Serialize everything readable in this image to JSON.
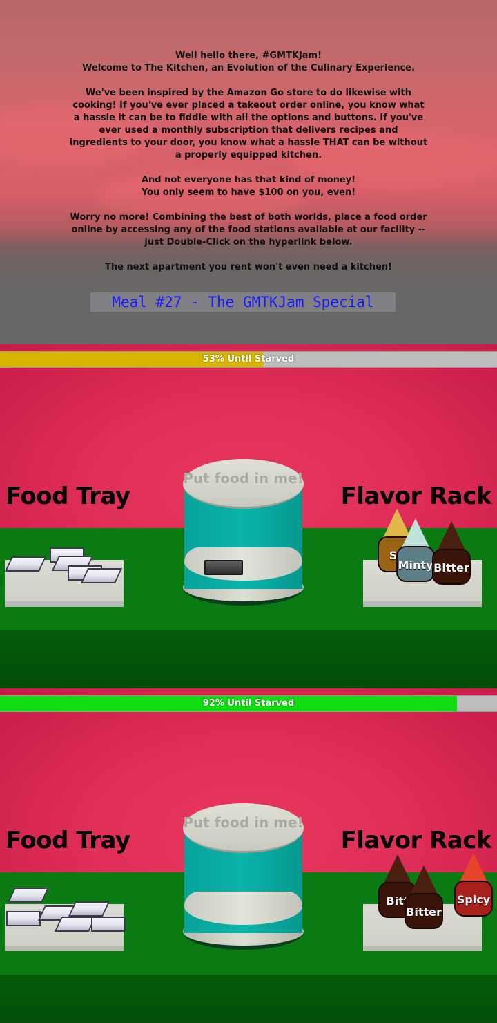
{
  "intro": {
    "paragraphs": [
      "Well hello there, #GMTKJam!\nWelcome to The Kitchen, an Evolution of the Culinary Experience.",
      "We've been inspired by the Amazon Go store to do likewise with cooking! If you've ever placed a takeout order online, you know what a hassle it can be to fiddle with all the options and buttons. If you've ever used a monthly subscription that delivers recipes and ingredients to your door, you know what a hassle THAT can be without a properly equipped kitchen.",
      "And not everyone has that kind of money!\nYou only seem to have $100 on you, even!",
      "Worry no more! Combining the best of both worlds, place a food order online by accessing any of the food stations available at our facility -- just Double-Click on the hyperlink below.",
      "The next apartment you rent won't even need a kitchen!"
    ],
    "link_text": "Meal #27 - The GMTKJam Special"
  },
  "scenes": [
    {
      "hunger": {
        "percent": 53,
        "label": "53% Until Starved",
        "color": "#d6b400"
      },
      "food_tray_title": "Food Tray",
      "flavor_rack_title": "Flavor Rack",
      "tube_label": "Put food in me!",
      "bottles": [
        {
          "label": "So",
          "cap": "#e0b84a",
          "body": "#9a6416"
        },
        {
          "label": "Minty",
          "cap": "#bfe3dc",
          "body": "#5f7f88"
        },
        {
          "label": "Bitter",
          "cap": "#4b1f10",
          "body": "#3a1409"
        }
      ]
    },
    {
      "hunger": {
        "percent": 92,
        "label": "92% Until Starved",
        "color": "#10dc10"
      },
      "food_tray_title": "Food Tray",
      "flavor_rack_title": "Flavor Rack",
      "tube_label": "Put food in me!",
      "bottles": [
        {
          "label": "Bitt",
          "cap": "#4b1f10",
          "body": "#3a1409"
        },
        {
          "label": "Bitter",
          "cap": "#4b1f10",
          "body": "#3a1409"
        },
        {
          "label": "Spicy",
          "cap": "#e8442c",
          "body": "#a8201c"
        }
      ]
    }
  ]
}
